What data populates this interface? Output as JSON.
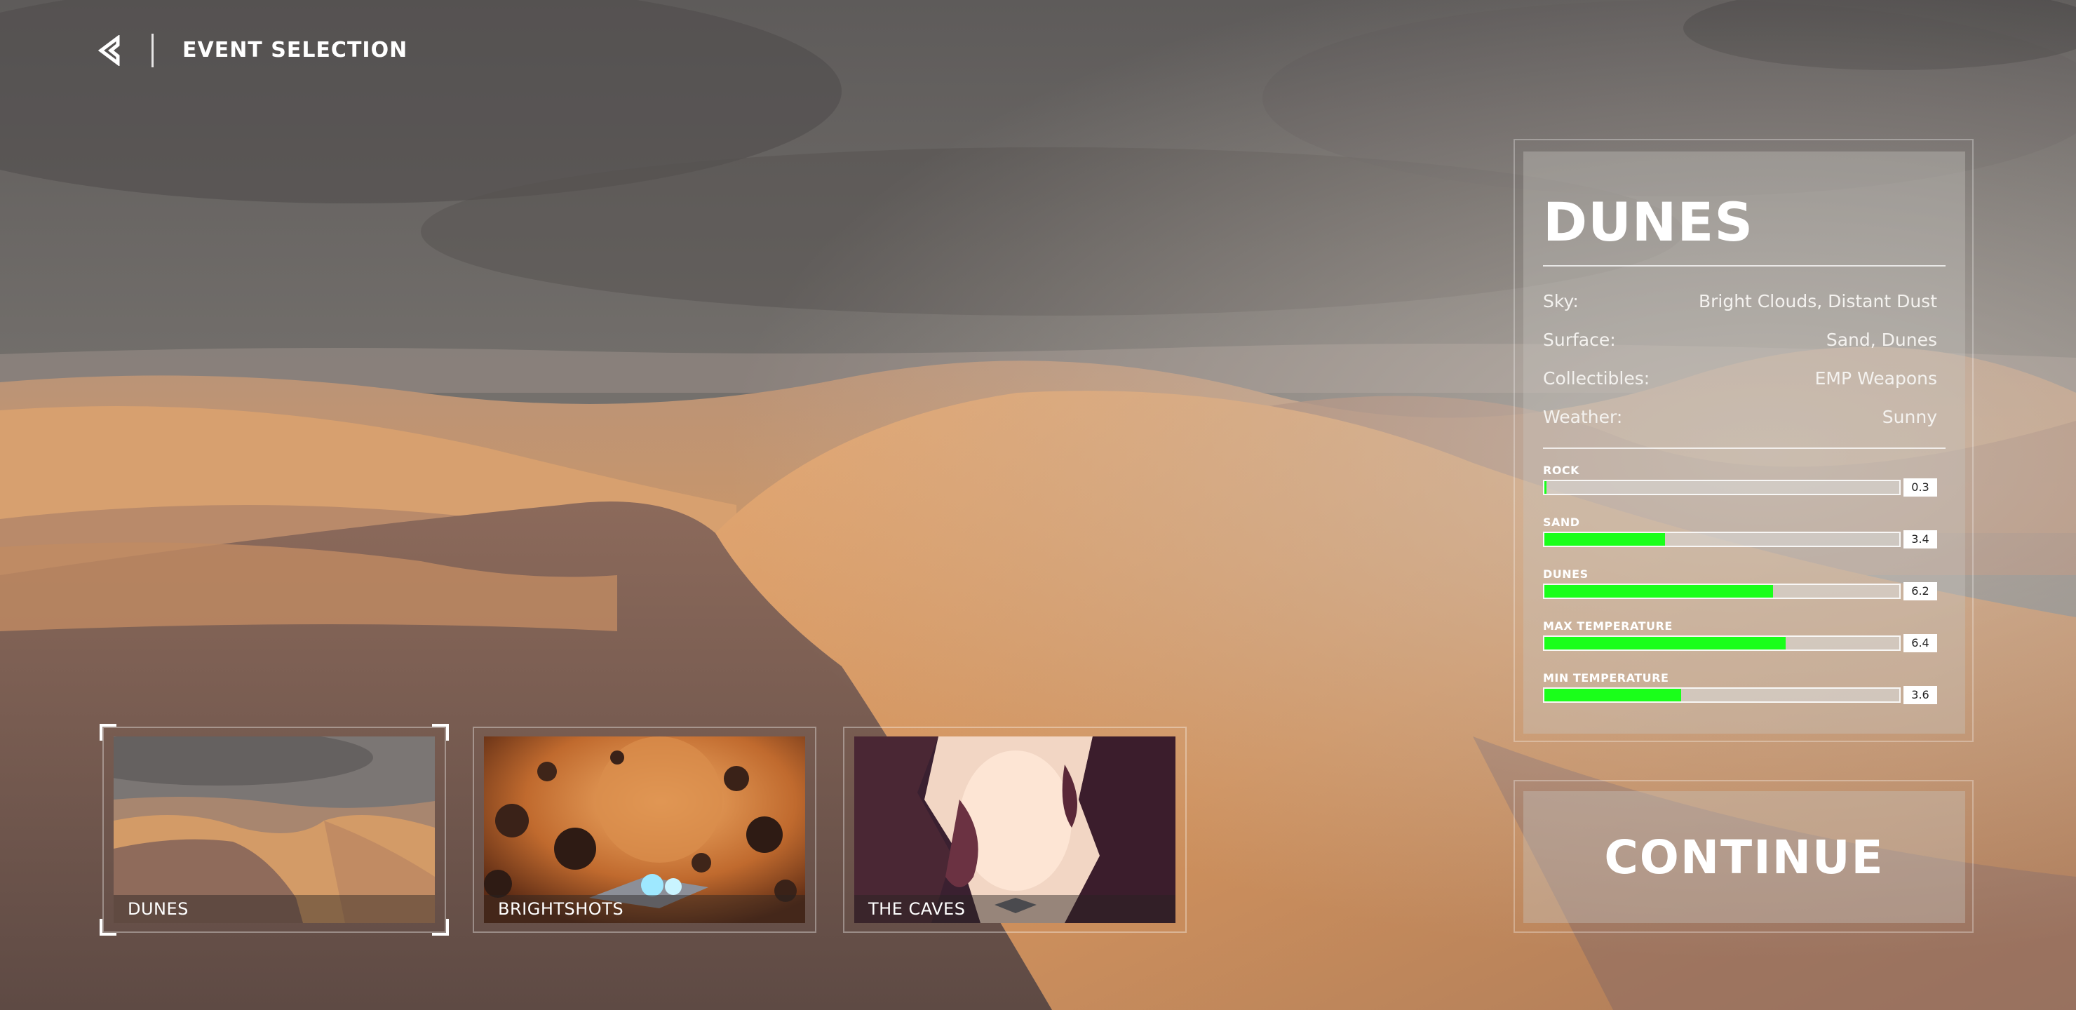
{
  "header": {
    "title": "EVENT SELECTION",
    "back_icon": "back-arrow-icon"
  },
  "selected_event": {
    "name": "DUNES",
    "properties": [
      {
        "label": "Sky:",
        "value": "Bright Clouds, Distant Dust"
      },
      {
        "label": "Surface:",
        "value": "Sand, Dunes"
      },
      {
        "label": "Collectibles:",
        "value": "EMP Weapons"
      },
      {
        "label": "Weather:",
        "value": "Sunny"
      }
    ],
    "stats": [
      {
        "label": "ROCK",
        "value": "0.3",
        "fraction": 0.006
      },
      {
        "label": "SAND",
        "value": "3.4",
        "fraction": 0.34
      },
      {
        "label": "DUNES",
        "value": "6.2",
        "fraction": 0.645
      },
      {
        "label": "MAX TEMPERATURE",
        "value": "6.4",
        "fraction": 0.68
      },
      {
        "label": "MIN TEMPERATURE",
        "value": "3.6",
        "fraction": 0.385
      }
    ]
  },
  "continue_label": "CONTINUE",
  "events": [
    {
      "label": "DUNES",
      "selected": true
    },
    {
      "label": "BRIGHTSHOTS",
      "selected": false
    },
    {
      "label": "THE CAVES",
      "selected": false
    }
  ],
  "colors": {
    "stat_fill": "#1aff1a",
    "panel_bg": "rgba(200,196,192,0.38)",
    "sand": "#d49a62",
    "sky": "#6a6766"
  }
}
